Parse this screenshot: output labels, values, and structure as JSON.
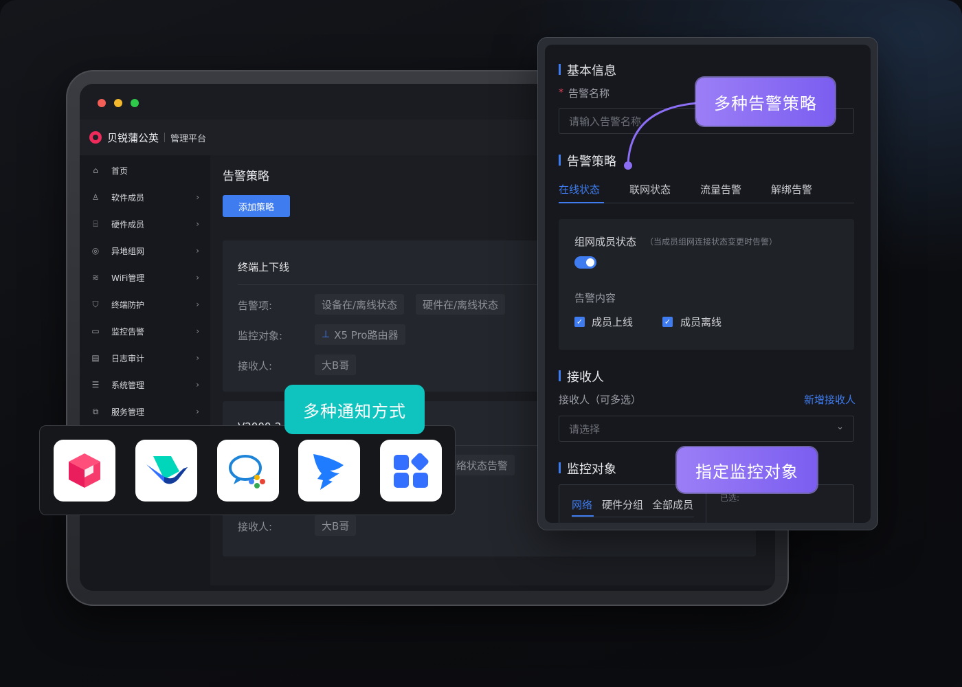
{
  "window": {
    "dots": [
      "#f35e57",
      "#f4b82c",
      "#2ec84a"
    ]
  },
  "app": {
    "name": "贝锐蒲公英",
    "subtitle": "管理平台"
  },
  "sidebar": {
    "items": [
      {
        "label": "首页",
        "icon": "home-icon",
        "glyph": "⌂",
        "chevron": false
      },
      {
        "label": "软件成员",
        "icon": "user-icon",
        "glyph": "♙",
        "chevron": true
      },
      {
        "label": "硬件成员",
        "icon": "router-icon",
        "glyph": "⌸",
        "chevron": true
      },
      {
        "label": "异地组网",
        "icon": "network-icon",
        "glyph": "◎",
        "chevron": true
      },
      {
        "label": "WiFi管理",
        "icon": "wifi-icon",
        "glyph": "≋",
        "chevron": true
      },
      {
        "label": "终端防护",
        "icon": "shield-icon",
        "glyph": "⛉",
        "chevron": true
      },
      {
        "label": "监控告警",
        "icon": "monitor-icon",
        "glyph": "▭",
        "chevron": true
      },
      {
        "label": "日志审计",
        "icon": "log-icon",
        "glyph": "▤",
        "chevron": true
      },
      {
        "label": "系统管理",
        "icon": "settings-icon",
        "glyph": "☰",
        "chevron": true
      },
      {
        "label": "服务管理",
        "icon": "service-icon",
        "glyph": "⧉",
        "chevron": true
      }
    ]
  },
  "main": {
    "title": "告警策略",
    "add_button": "添加策略",
    "card1": {
      "title": "终端上下线",
      "alert_items_label": "告警项:",
      "alert_items": [
        "设备在/离线状态",
        "硬件在/离线状态"
      ],
      "target_label": "监控对象:",
      "target_value": "X5 Pro路由器",
      "receiver_label": "接收人:",
      "receiver_value": "大B哥"
    },
    "card2": {
      "title": "V2000-2",
      "tag": "络状态告警",
      "receiver_label": "接收人:",
      "receiver_value": "大B哥"
    }
  },
  "badges": {
    "notify": "多种通知方式",
    "strategy": "多种告警策略",
    "target": "指定监控对象"
  },
  "notify_apps": [
    {
      "icon": "dingtalk-cube-icon"
    },
    {
      "icon": "feishu-icon"
    },
    {
      "icon": "wecom-icon"
    },
    {
      "icon": "dingtalk-icon"
    },
    {
      "icon": "app-grid-icon"
    }
  ],
  "panel": {
    "basic": {
      "section": "基本信息",
      "name_label": "告警名称",
      "required_mark": "*",
      "name_placeholder": "请输入告警名称"
    },
    "strategy": {
      "section": "告警策略",
      "tabs": [
        "在线状态",
        "联网状态",
        "流量告警",
        "解绑告警"
      ],
      "active_tab": 0,
      "box_title": "组网成员状态",
      "box_hint": "（当成员组网连接状态变更时告警）",
      "toggle_on": true,
      "content_label": "告警内容",
      "options": [
        {
          "label": "成员上线",
          "checked": true
        },
        {
          "label": "成员离线",
          "checked": true
        }
      ]
    },
    "receiver": {
      "section": "接收人",
      "label": "接收人（可多选）",
      "add_link": "新增接收人",
      "placeholder": "请选择"
    },
    "target": {
      "section": "监控对象",
      "tabs": [
        "网络",
        "硬件分组",
        "全部成员"
      ],
      "active_tab": 0,
      "selected_label": "已选:"
    }
  },
  "colors": {
    "accent": "#3f7cf0",
    "teal": "#0fc3be",
    "purple": "#8b6ef3"
  }
}
